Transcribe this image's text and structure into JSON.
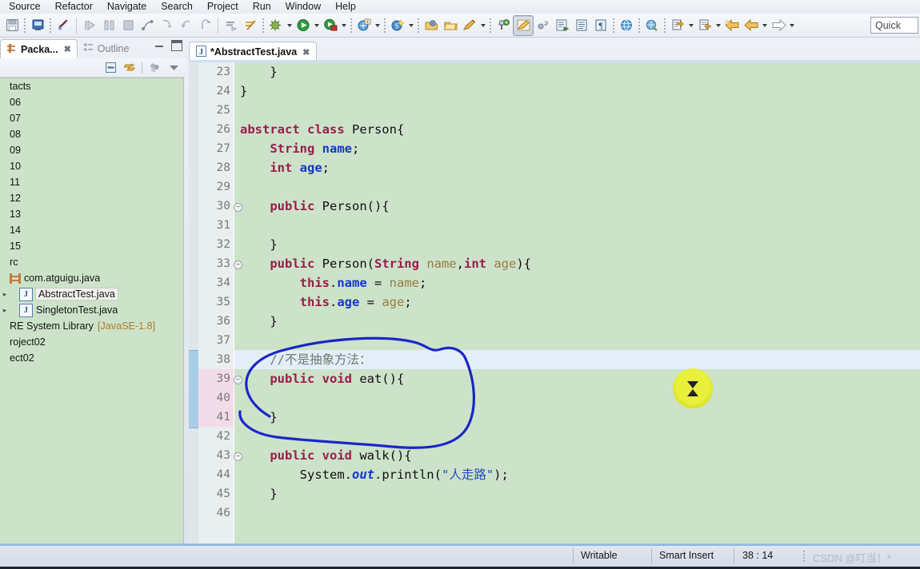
{
  "menubar": {
    "items": [
      {
        "label": "Source"
      },
      {
        "label": "Refactor"
      },
      {
        "label": "Navigate"
      },
      {
        "label": "Search"
      },
      {
        "label": "Project"
      },
      {
        "label": "Run"
      },
      {
        "label": "Window"
      },
      {
        "label": "Help"
      }
    ]
  },
  "toolbar": {
    "quick_access": "Quick",
    "buttons": [
      {
        "icon": "save-icon"
      },
      {
        "icon": "new-java-class-icon"
      },
      {
        "icon": "toggle-breakpoint-icon"
      },
      {
        "icon": "resume-icon"
      },
      {
        "icon": "suspend-icon"
      },
      {
        "icon": "terminate-icon"
      },
      {
        "icon": "disconnect-icon"
      },
      {
        "icon": "step-into-icon"
      },
      {
        "icon": "step-over-icon"
      },
      {
        "icon": "step-return-icon"
      },
      {
        "icon": "skip-breakpoints-icon"
      },
      {
        "icon": "run-last-tool-icon"
      },
      {
        "icon": "debug-icon"
      },
      {
        "icon": "run-icon"
      },
      {
        "icon": "coverage-icon"
      },
      {
        "icon": "new-wizard-icon"
      },
      {
        "icon": "new-spring-icon"
      },
      {
        "icon": "open-type-icon"
      },
      {
        "icon": "open-task-icon"
      },
      {
        "icon": "edit-icon"
      },
      {
        "icon": "pin-editor-icon"
      },
      {
        "icon": "highlight-pen-icon"
      },
      {
        "icon": "link-icon"
      },
      {
        "icon": "external-tools-icon"
      },
      {
        "icon": "toggle-block-selection-icon"
      },
      {
        "icon": "show-whitespace-icon"
      },
      {
        "icon": "open-web-browser-icon"
      },
      {
        "icon": "search-web-icon"
      },
      {
        "icon": "next-annotation-icon"
      },
      {
        "icon": "previous-annotation-icon"
      },
      {
        "icon": "back-icon"
      },
      {
        "icon": "forward-icon"
      }
    ]
  },
  "left_view": {
    "tabs": [
      {
        "label": "Packa...",
        "active": true,
        "icon": "package-explorer-icon"
      },
      {
        "label": "Outline",
        "active": false,
        "icon": "outline-icon"
      }
    ],
    "view_toolbar": [
      {
        "icon": "collapse-all-icon"
      },
      {
        "icon": "link-with-editor-icon"
      },
      {
        "icon": "focus-on-active-task-icon"
      },
      {
        "icon": "view-menu-icon"
      }
    ],
    "window_buttons": [
      {
        "icon": "minimize-icon"
      },
      {
        "icon": "maximize-icon"
      }
    ],
    "tree": [
      {
        "label": "tacts",
        "icon": "none",
        "indent": 0,
        "twisty": "",
        "selected": false,
        "suffix": ""
      },
      {
        "label": "06",
        "icon": "none",
        "indent": 0,
        "twisty": "",
        "selected": false,
        "suffix": ""
      },
      {
        "label": "07",
        "icon": "none",
        "indent": 0,
        "twisty": "",
        "selected": false,
        "suffix": ""
      },
      {
        "label": "08",
        "icon": "none",
        "indent": 0,
        "twisty": "",
        "selected": false,
        "suffix": ""
      },
      {
        "label": "09",
        "icon": "none",
        "indent": 0,
        "twisty": "",
        "selected": false,
        "suffix": ""
      },
      {
        "label": "10",
        "icon": "none",
        "indent": 0,
        "twisty": "",
        "selected": false,
        "suffix": ""
      },
      {
        "label": "11",
        "icon": "none",
        "indent": 0,
        "twisty": "",
        "selected": false,
        "suffix": ""
      },
      {
        "label": "12",
        "icon": "none",
        "indent": 0,
        "twisty": "",
        "selected": false,
        "suffix": ""
      },
      {
        "label": "13",
        "icon": "none",
        "indent": 0,
        "twisty": "",
        "selected": false,
        "suffix": ""
      },
      {
        "label": "14",
        "icon": "none",
        "indent": 0,
        "twisty": "",
        "selected": false,
        "suffix": ""
      },
      {
        "label": "15",
        "icon": "none",
        "indent": 0,
        "twisty": "",
        "selected": false,
        "suffix": ""
      },
      {
        "label": "rc",
        "icon": "none",
        "indent": 0,
        "twisty": "",
        "selected": false,
        "suffix": ""
      },
      {
        "label": "com.atguigu.java",
        "icon": "package",
        "indent": 0,
        "twisty": "",
        "selected": false,
        "suffix": ""
      },
      {
        "label": "AbstractTest.java",
        "icon": "java",
        "indent": 1,
        "twisty": "▸",
        "selected": true,
        "suffix": ""
      },
      {
        "label": "SingletonTest.java",
        "icon": "java",
        "indent": 1,
        "twisty": "▸",
        "selected": false,
        "suffix": ""
      },
      {
        "label": "RE System Library",
        "icon": "none",
        "indent": 0,
        "twisty": "",
        "selected": false,
        "suffix": "[JavaSE-1.8]"
      },
      {
        "label": "roject02",
        "icon": "none",
        "indent": 0,
        "twisty": "",
        "selected": false,
        "suffix": ""
      },
      {
        "label": "ect02",
        "icon": "none",
        "indent": 0,
        "twisty": "",
        "selected": false,
        "suffix": ""
      }
    ]
  },
  "editor": {
    "tab": {
      "label": "*AbstractTest.java",
      "icon": "java-file-icon",
      "close": "✕"
    },
    "first_line_number": 23,
    "highlighted_line": 38,
    "changed_lines": [
      39,
      40,
      41
    ],
    "change_bar_lines": [
      38,
      39,
      40,
      41
    ],
    "folding_lines": [
      30,
      33,
      39,
      43
    ],
    "lines": [
      {
        "n": 23,
        "tokens": [
          {
            "t": "    }",
            "c": ""
          }
        ]
      },
      {
        "n": 24,
        "tokens": [
          {
            "t": "}",
            "c": ""
          }
        ]
      },
      {
        "n": 25,
        "tokens": [
          {
            "t": "",
            "c": ""
          }
        ]
      },
      {
        "n": 26,
        "tokens": [
          {
            "t": "abstract class ",
            "c": "kw"
          },
          {
            "t": "Person{",
            "c": ""
          }
        ]
      },
      {
        "n": 27,
        "tokens": [
          {
            "t": "    ",
            "c": ""
          },
          {
            "t": "String ",
            "c": "kw"
          },
          {
            "t": "name",
            "c": "fld"
          },
          {
            "t": ";",
            "c": ""
          }
        ]
      },
      {
        "n": 28,
        "tokens": [
          {
            "t": "    ",
            "c": ""
          },
          {
            "t": "int ",
            "c": "kw"
          },
          {
            "t": "age",
            "c": "fld"
          },
          {
            "t": ";",
            "c": ""
          }
        ]
      },
      {
        "n": 29,
        "tokens": [
          {
            "t": "",
            "c": ""
          }
        ]
      },
      {
        "n": 30,
        "tokens": [
          {
            "t": "    ",
            "c": ""
          },
          {
            "t": "public ",
            "c": "kw"
          },
          {
            "t": "Person(){",
            "c": ""
          }
        ]
      },
      {
        "n": 31,
        "tokens": [
          {
            "t": "",
            "c": ""
          }
        ]
      },
      {
        "n": 32,
        "tokens": [
          {
            "t": "    }",
            "c": ""
          }
        ]
      },
      {
        "n": 33,
        "tokens": [
          {
            "t": "    ",
            "c": ""
          },
          {
            "t": "public ",
            "c": "kw"
          },
          {
            "t": "Person(",
            "c": ""
          },
          {
            "t": "String ",
            "c": "kw"
          },
          {
            "t": "name",
            "c": "par"
          },
          {
            "t": ",",
            "c": ""
          },
          {
            "t": "int ",
            "c": "kw"
          },
          {
            "t": "age",
            "c": "par"
          },
          {
            "t": "){",
            "c": ""
          }
        ]
      },
      {
        "n": 34,
        "tokens": [
          {
            "t": "        ",
            "c": ""
          },
          {
            "t": "this",
            "c": "kw"
          },
          {
            "t": ".",
            "c": ""
          },
          {
            "t": "name",
            "c": "fld"
          },
          {
            "t": " = ",
            "c": ""
          },
          {
            "t": "name",
            "c": "par"
          },
          {
            "t": ";",
            "c": ""
          }
        ]
      },
      {
        "n": 35,
        "tokens": [
          {
            "t": "        ",
            "c": ""
          },
          {
            "t": "this",
            "c": "kw"
          },
          {
            "t": ".",
            "c": ""
          },
          {
            "t": "age",
            "c": "fld"
          },
          {
            "t": " = ",
            "c": ""
          },
          {
            "t": "age",
            "c": "par"
          },
          {
            "t": ";",
            "c": ""
          }
        ]
      },
      {
        "n": 36,
        "tokens": [
          {
            "t": "    }",
            "c": ""
          }
        ]
      },
      {
        "n": 37,
        "tokens": [
          {
            "t": "",
            "c": ""
          }
        ]
      },
      {
        "n": 38,
        "tokens": [
          {
            "t": "    //不是抽象方法：",
            "c": "cmt"
          }
        ]
      },
      {
        "n": 39,
        "tokens": [
          {
            "t": "    ",
            "c": ""
          },
          {
            "t": "public void ",
            "c": "kw"
          },
          {
            "t": "eat(){",
            "c": ""
          }
        ]
      },
      {
        "n": 40,
        "tokens": [
          {
            "t": "",
            "c": ""
          }
        ]
      },
      {
        "n": 41,
        "tokens": [
          {
            "t": "    }",
            "c": ""
          }
        ]
      },
      {
        "n": 42,
        "tokens": [
          {
            "t": "",
            "c": ""
          }
        ]
      },
      {
        "n": 43,
        "tokens": [
          {
            "t": "    ",
            "c": ""
          },
          {
            "t": "public void ",
            "c": "kw"
          },
          {
            "t": "walk(){",
            "c": ""
          }
        ]
      },
      {
        "n": 44,
        "tokens": [
          {
            "t": "        System.",
            "c": ""
          },
          {
            "t": "out",
            "c": "stat"
          },
          {
            "t": ".println(",
            "c": ""
          },
          {
            "t": "\"人走路\"",
            "c": "str"
          },
          {
            "t": ");",
            "c": ""
          }
        ]
      },
      {
        "n": 45,
        "tokens": [
          {
            "t": "    }",
            "c": ""
          }
        ]
      },
      {
        "n": 46,
        "tokens": [
          {
            "t": "",
            "c": ""
          }
        ]
      }
    ]
  },
  "annotation": {
    "shape": "hand-drawn-blue-ellipse",
    "color": "#1a27c7",
    "encircles_lines": [
      38,
      39,
      40,
      41
    ]
  },
  "cursor": {
    "icon": "hourglass-busy-cursor",
    "highlight_color": "#e4ec2b"
  },
  "statusbar": {
    "writable": "Writable",
    "insert_mode": "Smart Insert",
    "position": "38 : 14",
    "watermark": "CSDN @叮当！*"
  }
}
